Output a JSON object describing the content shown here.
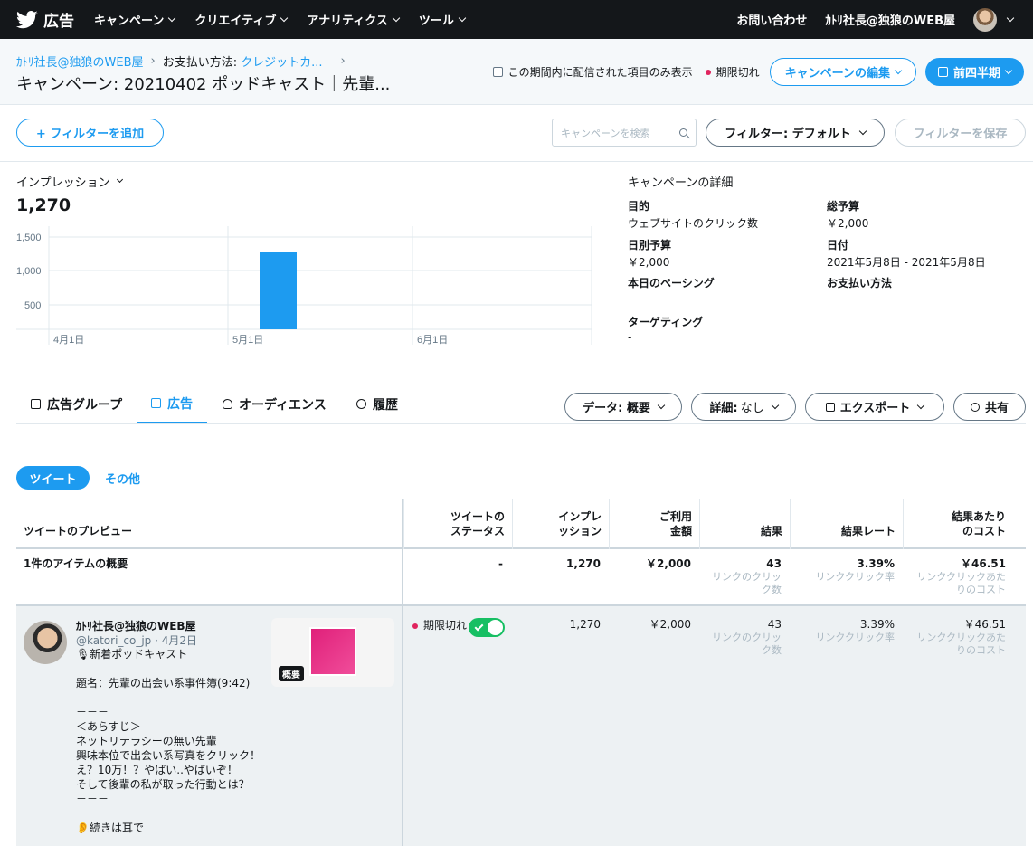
{
  "nav": {
    "logo_text": "広告",
    "items": [
      "キャンペーン",
      "クリエイティブ",
      "アナリティクス",
      "ツール"
    ],
    "contact": "お問い合わせ",
    "account": "ｶﾄﾘ社長@独狼のWEB屋"
  },
  "header": {
    "breadcrumb": {
      "account": "ｶﾄﾘ社長@独狼のWEB屋",
      "payment_label": "お支払い方法:",
      "payment_value": "クレジットカ...",
      "trailing_sep": "›"
    },
    "title": "キャンペーン: 20210402 ポッドキャスト｜先輩...",
    "checkbox_label": "この期間内に配信された項目のみ表示",
    "status": "期限切れ",
    "edit_button": "キャンペーンの編集",
    "period_button": "前四半期"
  },
  "filterbar": {
    "add_filter": "+ フィルターを追加",
    "search_placeholder": "キャンペーンを検索",
    "filter_button": "フィルター: デフォルト",
    "save_filter": "フィルターを保存"
  },
  "metric": {
    "label": "インプレッション",
    "value": "1,270"
  },
  "chart_data": {
    "type": "bar",
    "x_tick_labels": [
      "4月1日",
      "5月1日",
      "6月1日"
    ],
    "y_tick_labels": [
      "1,500",
      "1,000",
      "500"
    ],
    "ylim": [
      0,
      1700
    ],
    "categories": [
      "5月8日"
    ],
    "values": [
      1270
    ],
    "bar_color": "#1d9bf0"
  },
  "details": {
    "title": "キャンペーンの詳細",
    "items": [
      {
        "label": "目的",
        "value": "ウェブサイトのクリック数"
      },
      {
        "label": "総予算",
        "value": "￥2,000"
      },
      {
        "label": "日別予算",
        "value": "￥2,000"
      },
      {
        "label": "日付",
        "value": "2021年5月8日 - 2021年5月8日"
      },
      {
        "label": "本日のペーシング",
        "value": "-"
      },
      {
        "label": "お支払い方法",
        "value": "-"
      },
      {
        "label": "ターゲティング",
        "value": "-"
      }
    ]
  },
  "tabs": [
    "広告グループ",
    "広告",
    "オーディエンス",
    "履歴"
  ],
  "toolbar": {
    "data_label": "データ: 概要",
    "detail_label": "詳細:",
    "detail_value": "なし",
    "export_label": "エクスポート",
    "share_label": "共有"
  },
  "segments": {
    "active": "ツイート",
    "other": "その他"
  },
  "table": {
    "headers": [
      "ツイートのプレビュー",
      "ツイートの\nステータス",
      "インプレ\nッション",
      "ご利用\n金額",
      "結果",
      "結果レート",
      "結果あたり\nのコスト"
    ],
    "summary": {
      "label": "1件のアイテムの概要",
      "status": "-",
      "impressions": "1,270",
      "spend": "￥2,000",
      "results": "43",
      "results_sub": "リンクのクリッ\nク数",
      "rate": "3.39%",
      "rate_sub": "リンククリック率",
      "cost": "￥46.51",
      "cost_sub": "リンククリックあた\nりのコスト"
    },
    "ad": {
      "user": "ｶﾄﾘ社長@独狼のWEB屋",
      "meta": "@katori_co_jp · 4月2日",
      "text": "🎙新着ポッドキャスト\n\n題名：先輩の出会い系事件簿(9:42)\n\n－－－\n＜あらすじ＞\nネットリテラシーの無い先輩\n興味本位で出会い系写真をクリック！\nえ？10万！？やばい..やばいぞ！\nそして後輩の私が取った行動とは？\n－－－\n\n👂続きは耳で",
      "thumb_badge": "概要",
      "status": "期限切れ",
      "impressions": "1,270",
      "spend": "￥2,000",
      "results": "43",
      "results_sub": "リンクのクリッ\nク数",
      "rate": "3.39%",
      "rate_sub": "リンククリック率",
      "cost": "￥46.51",
      "cost_sub": "リンククリックあた\nりのコスト"
    }
  }
}
